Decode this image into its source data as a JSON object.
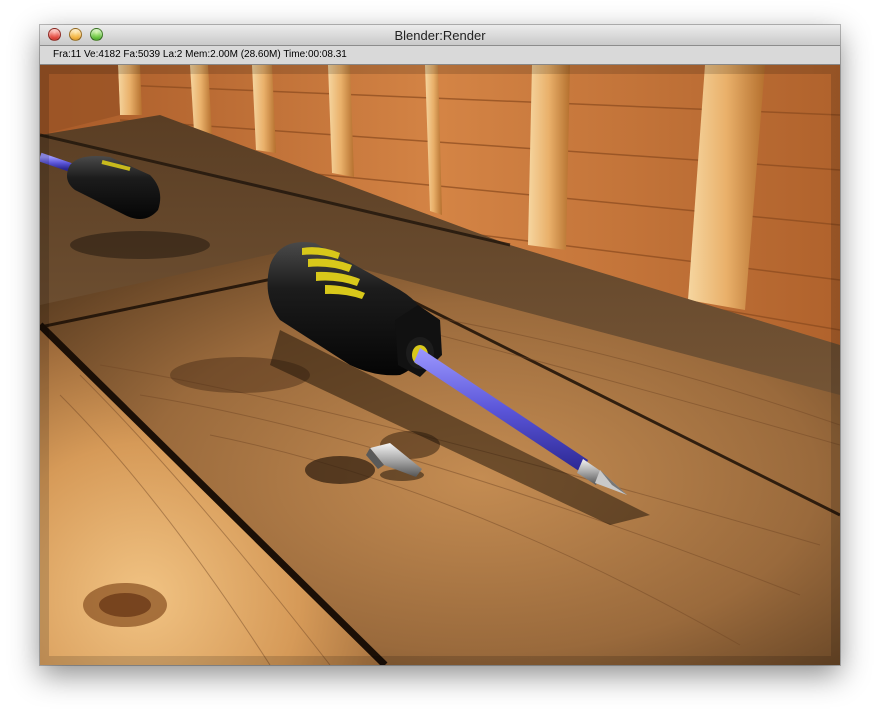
{
  "window": {
    "title": "Blender:Render",
    "controls": [
      "close-button",
      "minimize-button",
      "zoom-button"
    ]
  },
  "status_bar": {
    "text": "Fra:11  Ve:4182 Fa:5039 La:2 Mem:2.00M (28.60M) Time:00:08.31"
  },
  "render": {
    "subject": "screwdriver-and-bit-on-wooden-table",
    "colors": {
      "wood_light": "#d99a55",
      "wood_dark": "#6b4022",
      "handle": "#151515",
      "handle_grip": "#d8c81a",
      "shaft": "#5a55d8"
    }
  }
}
